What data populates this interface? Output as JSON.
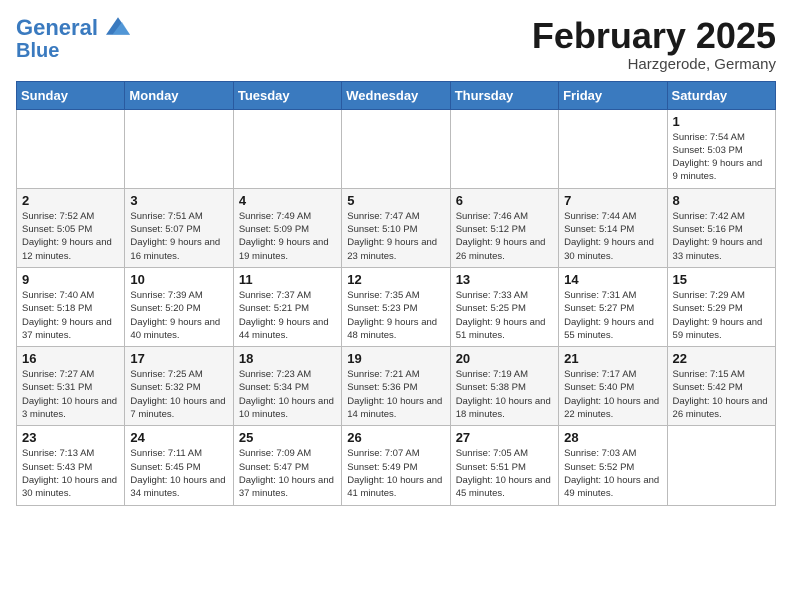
{
  "header": {
    "logo_line1": "General",
    "logo_line2": "Blue",
    "month_title": "February 2025",
    "subtitle": "Harzgerode, Germany"
  },
  "weekdays": [
    "Sunday",
    "Monday",
    "Tuesday",
    "Wednesday",
    "Thursday",
    "Friday",
    "Saturday"
  ],
  "weeks": [
    [
      {
        "day": "",
        "info": ""
      },
      {
        "day": "",
        "info": ""
      },
      {
        "day": "",
        "info": ""
      },
      {
        "day": "",
        "info": ""
      },
      {
        "day": "",
        "info": ""
      },
      {
        "day": "",
        "info": ""
      },
      {
        "day": "1",
        "info": "Sunrise: 7:54 AM\nSunset: 5:03 PM\nDaylight: 9 hours and 9 minutes."
      }
    ],
    [
      {
        "day": "2",
        "info": "Sunrise: 7:52 AM\nSunset: 5:05 PM\nDaylight: 9 hours and 12 minutes."
      },
      {
        "day": "3",
        "info": "Sunrise: 7:51 AM\nSunset: 5:07 PM\nDaylight: 9 hours and 16 minutes."
      },
      {
        "day": "4",
        "info": "Sunrise: 7:49 AM\nSunset: 5:09 PM\nDaylight: 9 hours and 19 minutes."
      },
      {
        "day": "5",
        "info": "Sunrise: 7:47 AM\nSunset: 5:10 PM\nDaylight: 9 hours and 23 minutes."
      },
      {
        "day": "6",
        "info": "Sunrise: 7:46 AM\nSunset: 5:12 PM\nDaylight: 9 hours and 26 minutes."
      },
      {
        "day": "7",
        "info": "Sunrise: 7:44 AM\nSunset: 5:14 PM\nDaylight: 9 hours and 30 minutes."
      },
      {
        "day": "8",
        "info": "Sunrise: 7:42 AM\nSunset: 5:16 PM\nDaylight: 9 hours and 33 minutes."
      }
    ],
    [
      {
        "day": "9",
        "info": "Sunrise: 7:40 AM\nSunset: 5:18 PM\nDaylight: 9 hours and 37 minutes."
      },
      {
        "day": "10",
        "info": "Sunrise: 7:39 AM\nSunset: 5:20 PM\nDaylight: 9 hours and 40 minutes."
      },
      {
        "day": "11",
        "info": "Sunrise: 7:37 AM\nSunset: 5:21 PM\nDaylight: 9 hours and 44 minutes."
      },
      {
        "day": "12",
        "info": "Sunrise: 7:35 AM\nSunset: 5:23 PM\nDaylight: 9 hours and 48 minutes."
      },
      {
        "day": "13",
        "info": "Sunrise: 7:33 AM\nSunset: 5:25 PM\nDaylight: 9 hours and 51 minutes."
      },
      {
        "day": "14",
        "info": "Sunrise: 7:31 AM\nSunset: 5:27 PM\nDaylight: 9 hours and 55 minutes."
      },
      {
        "day": "15",
        "info": "Sunrise: 7:29 AM\nSunset: 5:29 PM\nDaylight: 9 hours and 59 minutes."
      }
    ],
    [
      {
        "day": "16",
        "info": "Sunrise: 7:27 AM\nSunset: 5:31 PM\nDaylight: 10 hours and 3 minutes."
      },
      {
        "day": "17",
        "info": "Sunrise: 7:25 AM\nSunset: 5:32 PM\nDaylight: 10 hours and 7 minutes."
      },
      {
        "day": "18",
        "info": "Sunrise: 7:23 AM\nSunset: 5:34 PM\nDaylight: 10 hours and 10 minutes."
      },
      {
        "day": "19",
        "info": "Sunrise: 7:21 AM\nSunset: 5:36 PM\nDaylight: 10 hours and 14 minutes."
      },
      {
        "day": "20",
        "info": "Sunrise: 7:19 AM\nSunset: 5:38 PM\nDaylight: 10 hours and 18 minutes."
      },
      {
        "day": "21",
        "info": "Sunrise: 7:17 AM\nSunset: 5:40 PM\nDaylight: 10 hours and 22 minutes."
      },
      {
        "day": "22",
        "info": "Sunrise: 7:15 AM\nSunset: 5:42 PM\nDaylight: 10 hours and 26 minutes."
      }
    ],
    [
      {
        "day": "23",
        "info": "Sunrise: 7:13 AM\nSunset: 5:43 PM\nDaylight: 10 hours and 30 minutes."
      },
      {
        "day": "24",
        "info": "Sunrise: 7:11 AM\nSunset: 5:45 PM\nDaylight: 10 hours and 34 minutes."
      },
      {
        "day": "25",
        "info": "Sunrise: 7:09 AM\nSunset: 5:47 PM\nDaylight: 10 hours and 37 minutes."
      },
      {
        "day": "26",
        "info": "Sunrise: 7:07 AM\nSunset: 5:49 PM\nDaylight: 10 hours and 41 minutes."
      },
      {
        "day": "27",
        "info": "Sunrise: 7:05 AM\nSunset: 5:51 PM\nDaylight: 10 hours and 45 minutes."
      },
      {
        "day": "28",
        "info": "Sunrise: 7:03 AM\nSunset: 5:52 PM\nDaylight: 10 hours and 49 minutes."
      },
      {
        "day": "",
        "info": ""
      }
    ]
  ]
}
